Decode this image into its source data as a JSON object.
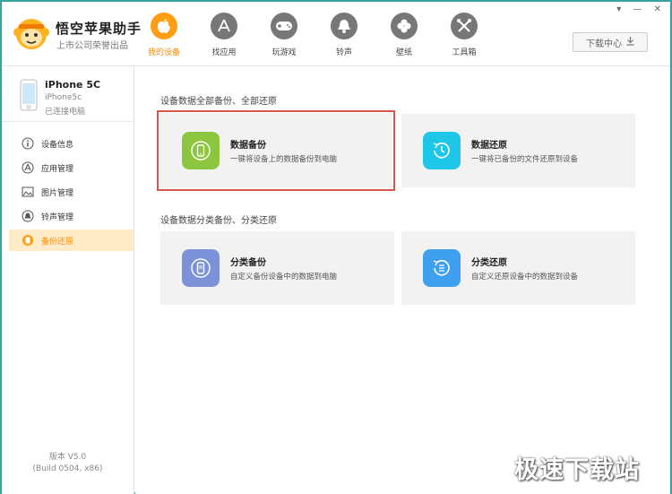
{
  "app": {
    "title": "悟空苹果助手",
    "subtitle": "上市公司荣誉出品"
  },
  "nav": [
    {
      "label": "我的设备",
      "icon": "apple-icon",
      "active": true
    },
    {
      "label": "找应用",
      "icon": "app-store-icon",
      "active": false
    },
    {
      "label": "玩游戏",
      "icon": "gamepad-icon",
      "active": false
    },
    {
      "label": "铃声",
      "icon": "bell-icon",
      "active": false
    },
    {
      "label": "壁纸",
      "icon": "clover-icon",
      "active": false
    },
    {
      "label": "工具箱",
      "icon": "tools-icon",
      "active": false
    }
  ],
  "window_controls": {
    "menu": "▾",
    "minimize": "—",
    "close": "✕"
  },
  "download_button": {
    "label": "下载中心"
  },
  "device": {
    "name": "iPhone 5C",
    "model": "iPhone5c",
    "status": "已连接电脑"
  },
  "sidebar": {
    "items": [
      {
        "label": "设备信息",
        "icon": "info-icon",
        "active": false
      },
      {
        "label": "应用管理",
        "icon": "app-manage-icon",
        "active": false
      },
      {
        "label": "图片管理",
        "icon": "image-icon",
        "active": false
      },
      {
        "label": "铃声管理",
        "icon": "bell-icon",
        "active": false
      },
      {
        "label": "备份还原",
        "icon": "backup-icon",
        "active": true
      }
    ]
  },
  "version": {
    "line1": "版本 V5.0",
    "line2": "(Build 0504, x86)"
  },
  "main": {
    "section_all": {
      "title": "设备数据全部备份、全部还原",
      "cards": [
        {
          "title": "数据备份",
          "desc": "一键将设备上的数据备份到电脑",
          "icon": "phone-backup-icon",
          "color": "#8cc63f",
          "highlighted": true
        },
        {
          "title": "数据还原",
          "desc": "一键将已备份的文件还原到设备",
          "icon": "restore-clock-icon",
          "color": "#1ec6e8",
          "highlighted": false
        }
      ]
    },
    "section_category": {
      "title": "设备数据分类备份、分类还原",
      "cards": [
        {
          "title": "分类备份",
          "desc": "自定义备份设备中的数据到电脑",
          "icon": "category-backup-icon",
          "color": "#7b92d8",
          "highlighted": false
        },
        {
          "title": "分类还原",
          "desc": "自定义还原设备中的数据到设备",
          "icon": "category-restore-icon",
          "color": "#3ea0ef",
          "highlighted": false
        }
      ]
    }
  },
  "watermark": "极速下载站",
  "colors": {
    "accent": "#ff9d13",
    "border": "#34a5a0",
    "highlight": "#d9534f"
  }
}
